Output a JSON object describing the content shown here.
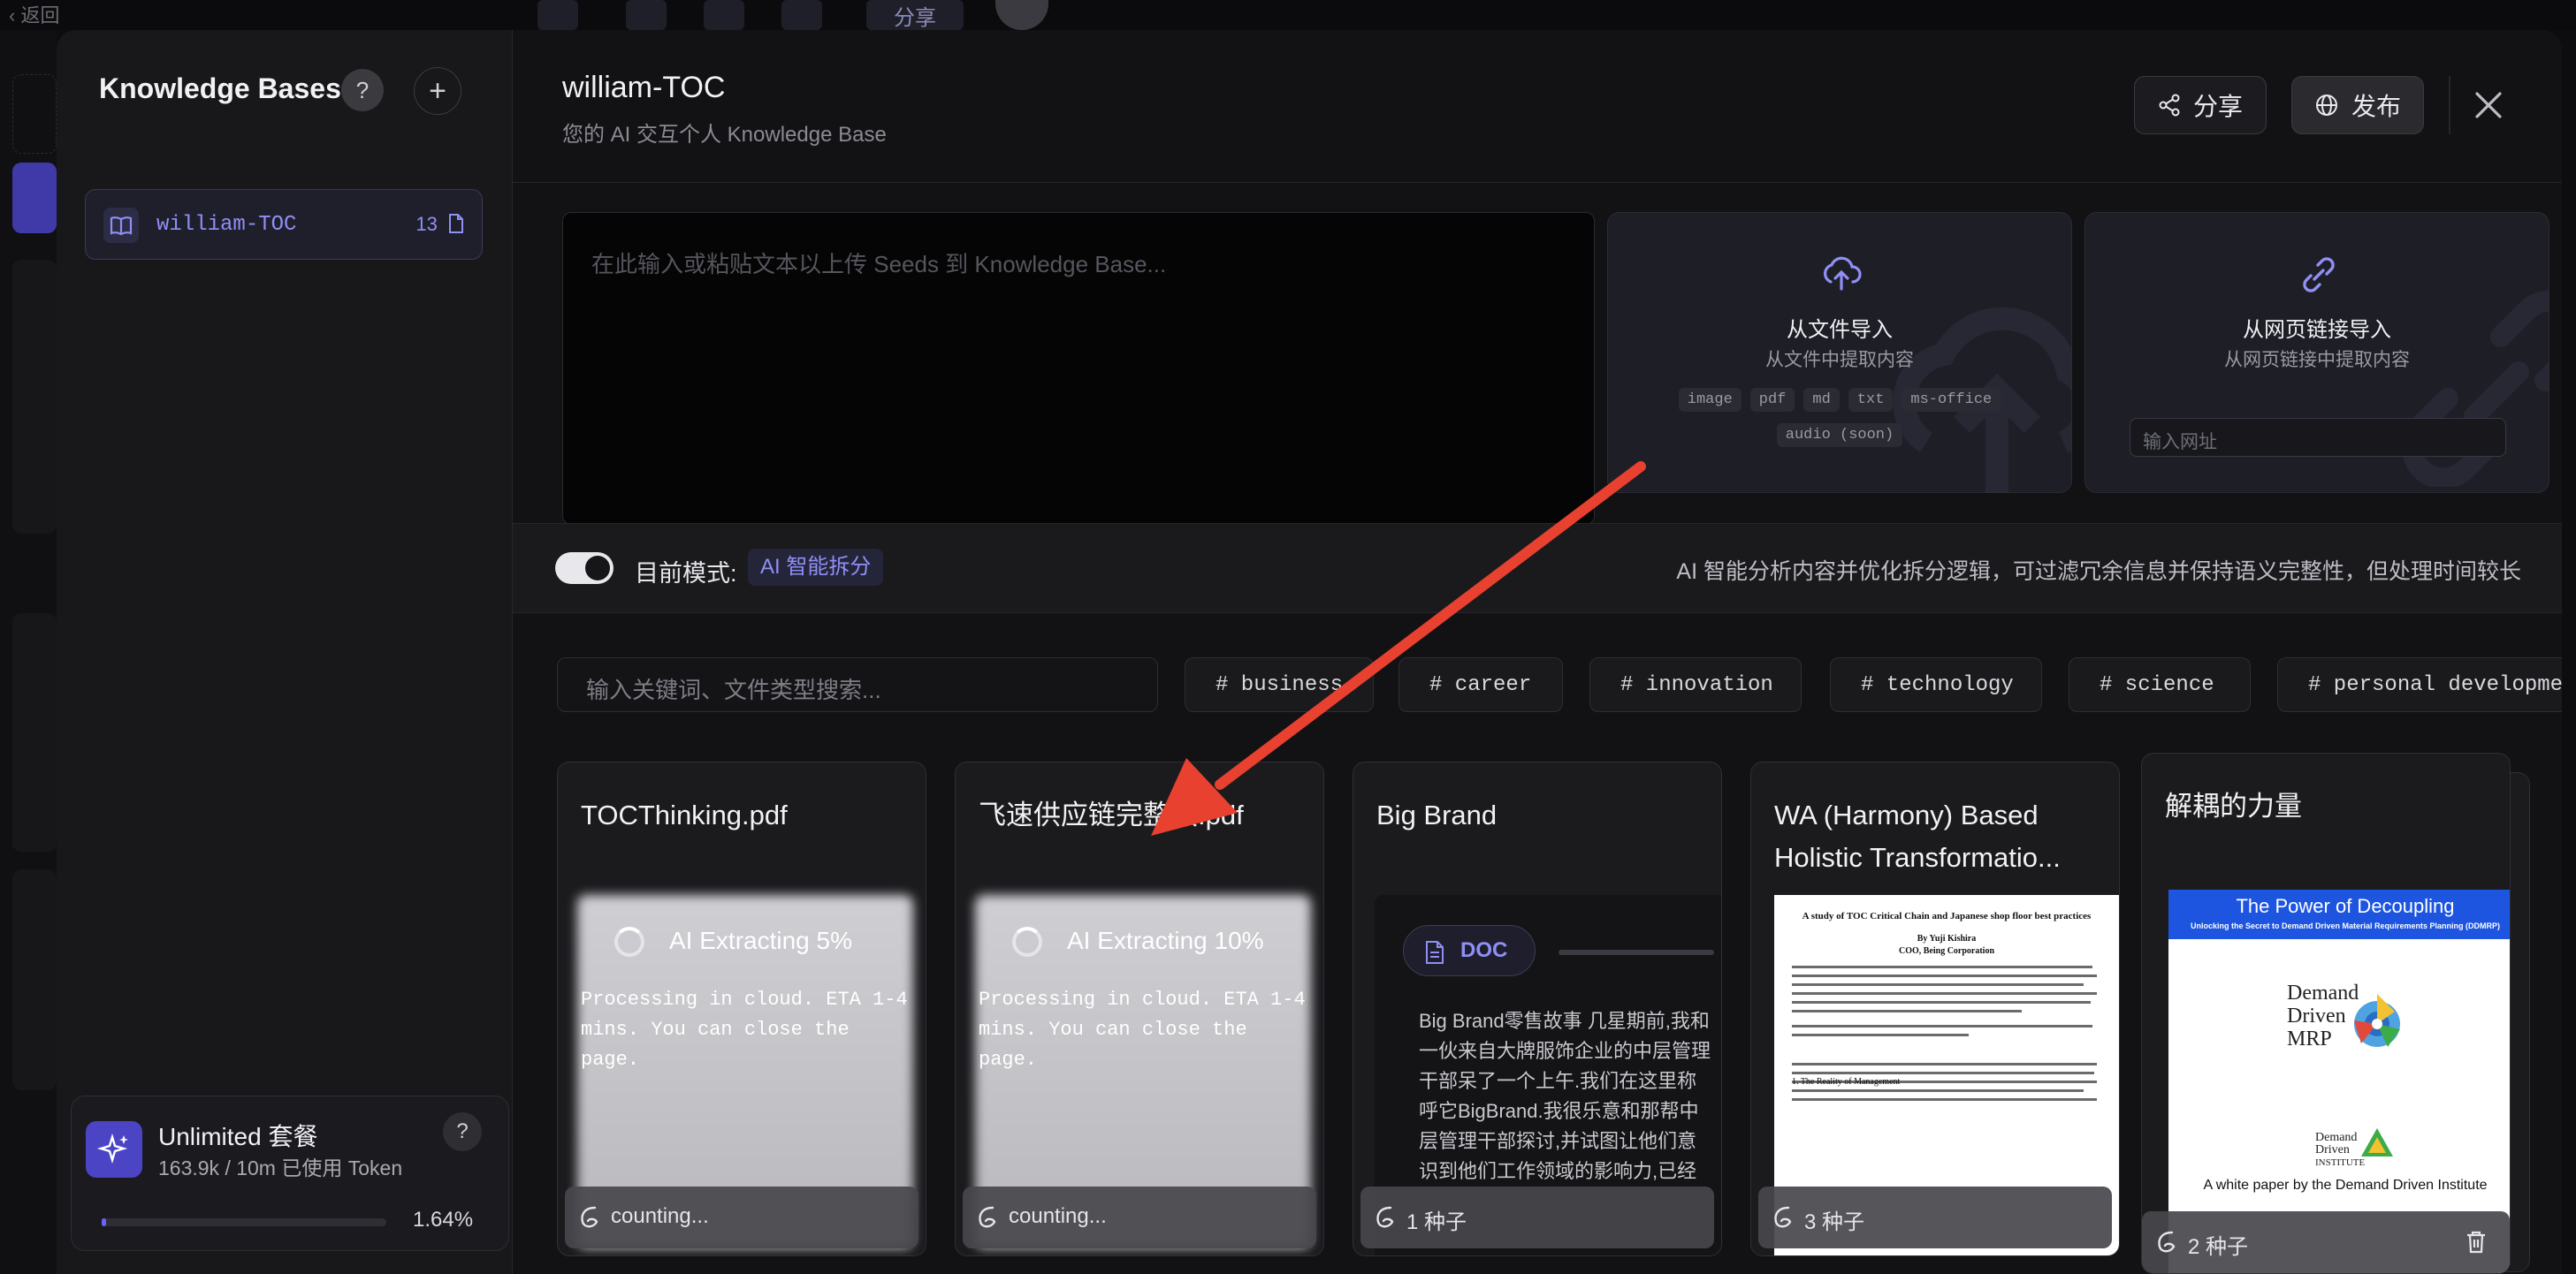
{
  "background_app": {
    "back_label": "返回",
    "share_label": "分享"
  },
  "sidebar": {
    "title": "Knowledge Bases",
    "help_glyph": "?",
    "add_glyph": "+",
    "items": [
      {
        "name": "william-TOC",
        "count": "13"
      }
    ],
    "plan": {
      "name": "Unlimited 套餐",
      "usage": "163.9k / 10m 已使用 Token",
      "percent_label": "1.64%",
      "percent": 1.64,
      "help_glyph": "?"
    }
  },
  "header": {
    "title": "william-TOC",
    "subtitle": "您的 AI 交互个人 Knowledge Base",
    "share_label": "分享",
    "publish_label": "发布"
  },
  "upload": {
    "placeholder": "在此输入或粘贴文本以上传 Seeds 到 Knowledge Base...",
    "file_import": {
      "title": "从文件导入",
      "subtitle": "从文件中提取内容",
      "types": [
        "image",
        "pdf",
        "md",
        "txt",
        "ms-office"
      ],
      "extra_type": "audio (soon)"
    },
    "url_import": {
      "title": "从网页链接导入",
      "subtitle": "从网页链接中提取内容",
      "url_placeholder": "输入网址"
    }
  },
  "mode": {
    "label": "目前模式:",
    "badge": "AI 智能拆分",
    "description": "AI 智能分析内容并优化拆分逻辑，可过滤冗余信息并保持语义完整性，但处理时间较长",
    "enabled": true
  },
  "filter": {
    "search_placeholder": "输入关键词、文件类型搜索...",
    "tags": [
      "# business",
      "# career",
      "# innovation",
      "# technology",
      "# science",
      "# personal development"
    ]
  },
  "cards": [
    {
      "title": "TOCThinking.pdf",
      "status": "AI Extracting 5%",
      "progress": 5,
      "processing": "Processing in cloud. ETA 1-4 mins. You can close the page.",
      "footer": "counting..."
    },
    {
      "title": "飞速供应链完整版.pdf",
      "status": "AI Extracting 10%",
      "progress": 10,
      "processing": "Processing in cloud. ETA 1-4 mins. You can close the page.",
      "footer": "counting..."
    },
    {
      "title": "Big Brand",
      "doc_label": "DOC",
      "excerpt": "Big Brand零售故事 几星期前,我和一伙来自大牌服饰企业的中层管理干部呆了一个上午.我们在这里称呼它BigBrand.我很乐意和那帮中层管理干部探讨,并试图让他们意识到他们工作领域的影响力,已经超过...",
      "footer": "1 种子"
    },
    {
      "title": "WA (Harmony) Based Holistic Transformatio...",
      "footer": "3 种子",
      "paper": {
        "heading": "A study of TOC Critical Chain and Japanese shop floor best practices",
        "author": "By Yuji Kishira",
        "role": "COO, Being Corporation",
        "section": "1.   The Reality of Management"
      }
    },
    {
      "title": "解耦的力量",
      "footer": "2 种子",
      "cover": {
        "title": "The Power of Decoupling",
        "subtitle": "Unlocking the Secret to Demand Driven Material Requirements Planning (DDMRP)",
        "logo_text": [
          "Demand",
          "Driven",
          "MRP"
        ],
        "institute": [
          "Demand",
          "Driven",
          "INSTITUTE"
        ],
        "caption": "A white paper by the Demand Driven Institute"
      }
    }
  ],
  "colors": {
    "accent": "#8f8ff5",
    "arrow": "#e8412f",
    "plan_icon": "#4b45c6"
  }
}
